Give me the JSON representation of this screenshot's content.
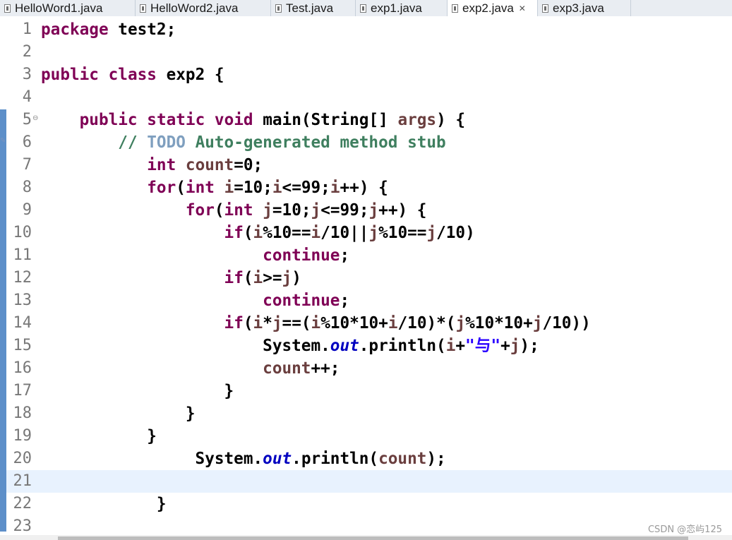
{
  "tabs": [
    {
      "label": "HelloWord1.java",
      "active": false,
      "closable": false
    },
    {
      "label": "HelloWord2.java",
      "active": false,
      "closable": false
    },
    {
      "label": "Test.java",
      "active": false,
      "closable": false
    },
    {
      "label": "exp1.java",
      "active": false,
      "closable": false
    },
    {
      "label": "exp2.java",
      "active": true,
      "closable": true
    },
    {
      "label": "exp3.java",
      "active": false,
      "closable": false
    }
  ],
  "editor": {
    "current_line": 21,
    "lines": [
      {
        "n": "1",
        "tokens": [
          {
            "t": "kw",
            "v": "package"
          },
          {
            "t": "p",
            "v": " test2;"
          }
        ]
      },
      {
        "n": "2",
        "tokens": []
      },
      {
        "n": "3",
        "tokens": [
          {
            "t": "kw",
            "v": "public"
          },
          {
            "t": "p",
            "v": " "
          },
          {
            "t": "kw",
            "v": "class"
          },
          {
            "t": "p",
            "v": " exp2 {"
          }
        ]
      },
      {
        "n": "4",
        "tokens": []
      },
      {
        "n": "5",
        "tokens": [
          {
            "t": "p",
            "v": "    "
          },
          {
            "t": "kw",
            "v": "public"
          },
          {
            "t": "p",
            "v": " "
          },
          {
            "t": "kw",
            "v": "static"
          },
          {
            "t": "p",
            "v": " "
          },
          {
            "t": "kw",
            "v": "void"
          },
          {
            "t": "p",
            "v": " main(String[] "
          },
          {
            "t": "var",
            "v": "args"
          },
          {
            "t": "p",
            "v": ") {"
          }
        ]
      },
      {
        "n": "6",
        "tokens": [
          {
            "t": "p",
            "v": "        "
          },
          {
            "t": "com",
            "v": "// "
          },
          {
            "t": "todo",
            "v": "TODO"
          },
          {
            "t": "com",
            "v": " Auto-generated method stub"
          }
        ]
      },
      {
        "n": "7",
        "tokens": [
          {
            "t": "p",
            "v": "           "
          },
          {
            "t": "kw",
            "v": "int"
          },
          {
            "t": "p",
            "v": " "
          },
          {
            "t": "var",
            "v": "count"
          },
          {
            "t": "p",
            "v": "=0;"
          }
        ]
      },
      {
        "n": "8",
        "tokens": [
          {
            "t": "p",
            "v": "           "
          },
          {
            "t": "kw",
            "v": "for"
          },
          {
            "t": "p",
            "v": "("
          },
          {
            "t": "kw",
            "v": "int"
          },
          {
            "t": "p",
            "v": " "
          },
          {
            "t": "var",
            "v": "i"
          },
          {
            "t": "p",
            "v": "=10;"
          },
          {
            "t": "var",
            "v": "i"
          },
          {
            "t": "p",
            "v": "<=99;"
          },
          {
            "t": "var",
            "v": "i"
          },
          {
            "t": "p",
            "v": "++) {"
          }
        ]
      },
      {
        "n": "9",
        "tokens": [
          {
            "t": "p",
            "v": "               "
          },
          {
            "t": "kw",
            "v": "for"
          },
          {
            "t": "p",
            "v": "("
          },
          {
            "t": "kw",
            "v": "int"
          },
          {
            "t": "p",
            "v": " "
          },
          {
            "t": "var",
            "v": "j"
          },
          {
            "t": "p",
            "v": "=10;"
          },
          {
            "t": "var",
            "v": "j"
          },
          {
            "t": "p",
            "v": "<=99;"
          },
          {
            "t": "var",
            "v": "j"
          },
          {
            "t": "p",
            "v": "++) {"
          }
        ]
      },
      {
        "n": "10",
        "tokens": [
          {
            "t": "p",
            "v": "                   "
          },
          {
            "t": "kw",
            "v": "if"
          },
          {
            "t": "p",
            "v": "("
          },
          {
            "t": "var",
            "v": "i"
          },
          {
            "t": "p",
            "v": "%10=="
          },
          {
            "t": "var",
            "v": "i"
          },
          {
            "t": "p",
            "v": "/10||"
          },
          {
            "t": "var",
            "v": "j"
          },
          {
            "t": "p",
            "v": "%10=="
          },
          {
            "t": "var",
            "v": "j"
          },
          {
            "t": "p",
            "v": "/10)"
          }
        ]
      },
      {
        "n": "11",
        "tokens": [
          {
            "t": "p",
            "v": "                       "
          },
          {
            "t": "kw",
            "v": "continue"
          },
          {
            "t": "p",
            "v": ";"
          }
        ]
      },
      {
        "n": "12",
        "tokens": [
          {
            "t": "p",
            "v": "                   "
          },
          {
            "t": "kw",
            "v": "if"
          },
          {
            "t": "p",
            "v": "("
          },
          {
            "t": "var",
            "v": "i"
          },
          {
            "t": "p",
            "v": ">="
          },
          {
            "t": "var",
            "v": "j"
          },
          {
            "t": "p",
            "v": ")"
          }
        ]
      },
      {
        "n": "13",
        "tokens": [
          {
            "t": "p",
            "v": "                       "
          },
          {
            "t": "kw",
            "v": "continue"
          },
          {
            "t": "p",
            "v": ";"
          }
        ]
      },
      {
        "n": "14",
        "tokens": [
          {
            "t": "p",
            "v": "                   "
          },
          {
            "t": "kw",
            "v": "if"
          },
          {
            "t": "p",
            "v": "("
          },
          {
            "t": "var",
            "v": "i"
          },
          {
            "t": "p",
            "v": "*"
          },
          {
            "t": "var",
            "v": "j"
          },
          {
            "t": "p",
            "v": "==("
          },
          {
            "t": "var",
            "v": "i"
          },
          {
            "t": "p",
            "v": "%10*10+"
          },
          {
            "t": "var",
            "v": "i"
          },
          {
            "t": "p",
            "v": "/10)*("
          },
          {
            "t": "var",
            "v": "j"
          },
          {
            "t": "p",
            "v": "%10*10+"
          },
          {
            "t": "var",
            "v": "j"
          },
          {
            "t": "p",
            "v": "/10))"
          }
        ]
      },
      {
        "n": "15",
        "tokens": [
          {
            "t": "p",
            "v": "                       System."
          },
          {
            "t": "fld",
            "v": "out"
          },
          {
            "t": "p",
            "v": ".println("
          },
          {
            "t": "var",
            "v": "i"
          },
          {
            "t": "p",
            "v": "+"
          },
          {
            "t": "str",
            "v": "\"与\""
          },
          {
            "t": "p",
            "v": "+"
          },
          {
            "t": "var",
            "v": "j"
          },
          {
            "t": "p",
            "v": ");"
          }
        ]
      },
      {
        "n": "16",
        "tokens": [
          {
            "t": "p",
            "v": "                       "
          },
          {
            "t": "var",
            "v": "count"
          },
          {
            "t": "p",
            "v": "++;"
          }
        ]
      },
      {
        "n": "17",
        "tokens": [
          {
            "t": "p",
            "v": "                   }"
          }
        ]
      },
      {
        "n": "18",
        "tokens": [
          {
            "t": "p",
            "v": "               }"
          }
        ]
      },
      {
        "n": "19",
        "tokens": [
          {
            "t": "p",
            "v": "           }"
          }
        ]
      },
      {
        "n": "20",
        "tokens": [
          {
            "t": "p",
            "v": "                System."
          },
          {
            "t": "fld",
            "v": "out"
          },
          {
            "t": "p",
            "v": ".println("
          },
          {
            "t": "var",
            "v": "count"
          },
          {
            "t": "p",
            "v": ");"
          }
        ]
      },
      {
        "n": "21",
        "tokens": []
      },
      {
        "n": "22",
        "tokens": [
          {
            "t": "p",
            "v": "            }"
          }
        ]
      },
      {
        "n": "23",
        "tokens": []
      }
    ]
  },
  "gutter": {
    "fold_marker": "⊖",
    "ruler_marker": "✎"
  },
  "watermark": "CSDN @恋屿125",
  "colors": {
    "keyword": "#7f0055",
    "variable": "#6a3e3e",
    "field": "#0000c0",
    "string": "#2a00ff",
    "comment": "#3f7f5f",
    "todo": "#7f9fbf",
    "current_line": "#e8f2fe",
    "change_bar": "#5d8fc9"
  }
}
